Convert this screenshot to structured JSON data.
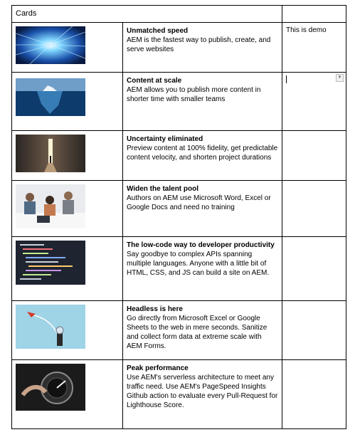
{
  "table": {
    "header": "Cards",
    "rows": [
      {
        "title": "Unmatched speed",
        "body": "AEM is the fastest way to publish, create, and serve websites",
        "extra": "This is demo",
        "image": "speed-light-tunnel"
      },
      {
        "title": "Content at scale",
        "body": "AEM allows you to publish more content in shorter time with smaller teams",
        "extra": "",
        "image": "iceberg"
      },
      {
        "title": "Uncertainty eliminated",
        "body": "Preview content at 100% fidelity, get predictable content velocity, and shorten project durations",
        "extra": "",
        "image": "doorway-light"
      },
      {
        "title": "Widen the talent pool",
        "body": "Authors on AEM use Microsoft Word, Excel or Google Docs and need no training",
        "extra": "",
        "image": "team-meeting"
      },
      {
        "title": "The low-code way to developer productivity",
        "body": "Say goodbye to complex APIs spanning multiple languages. Anyone with a little bit of HTML, CSS, and JS can build a site on AEM.",
        "extra": "",
        "image": "code-screen"
      },
      {
        "title": "Headless is here",
        "body": "Go directly from Microsoft Excel or Google Sheets to the web in mere seconds. Sanitize and collect form data at extreme scale with AEM Forms.",
        "extra": "",
        "image": "rocket-figure"
      },
      {
        "title": "Peak performance",
        "body": "Use AEM's serverless architecture to meet any traffic need. Use AEM's PageSpeed Insights Github action to evaluate every Pull-Request for Lighthouse Score.",
        "extra": "",
        "image": "speed-dial"
      }
    ]
  }
}
